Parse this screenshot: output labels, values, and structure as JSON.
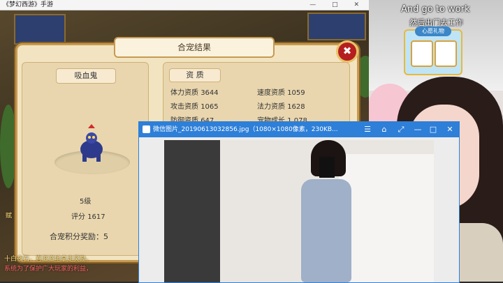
{
  "game": {
    "window_title": "《梦幻西游》手游"
  },
  "dialog": {
    "title": "合宠结果",
    "close_label": "✖",
    "pet_name": "吸血鬼",
    "pet_level": "5级",
    "score_label": "评分",
    "score_value": "1617",
    "aptitude_label": "资  质",
    "stats": [
      {
        "label": "体力资质",
        "value": "3644"
      },
      {
        "label": "速度资质",
        "value": "1059"
      },
      {
        "label": "攻击资质",
        "value": "1065"
      },
      {
        "label": "法力资质",
        "value": "1628"
      },
      {
        "label": "防御资质",
        "value": "647"
      },
      {
        "label": "宠物成长",
        "value": "1.078"
      }
    ],
    "reward_label": "合宠积分奖励",
    "reward_value": "5"
  },
  "viewer": {
    "title": "微信图片_20190613032856.jpg（1080×1080像素，230KB..."
  },
  "stream": {
    "caption_en": "And go to work",
    "caption_cn": "然后出门去工作",
    "gift_title": "心愿礼物"
  },
  "chat": [
    "赋",
    "十白夜石，喜滋滋地拿走奖励。",
    "系统为了保护广大玩家的利益，"
  ],
  "colors": {
    "accent": "#2d7fd8",
    "dialog_bg": "#f2e4c0",
    "close_red": "#b51f1f"
  }
}
